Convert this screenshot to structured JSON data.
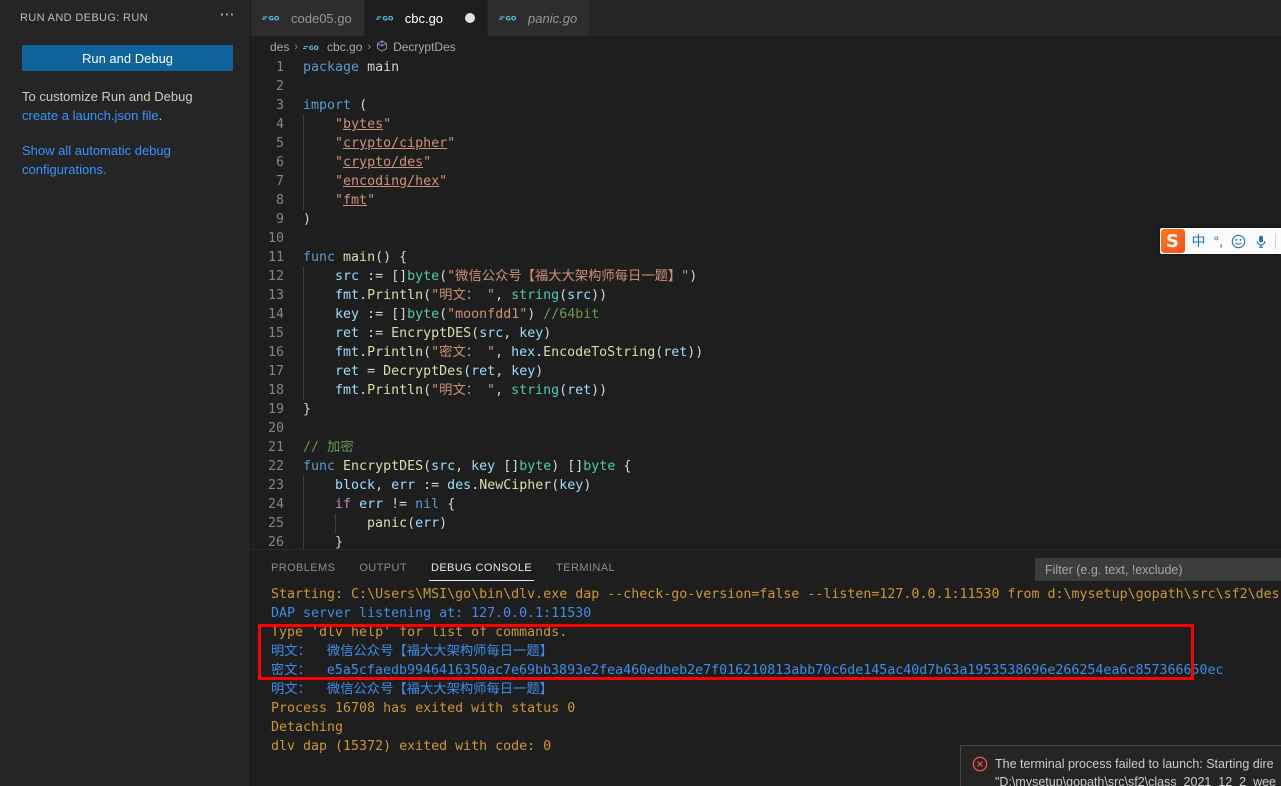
{
  "sidebar": {
    "header_title": "RUN AND DEBUG: RUN",
    "more_icon": "ellipsis-icon",
    "run_button_label": "Run and Debug",
    "hint_prefix": "To customize Run and Debug ",
    "hint_link": "create a launch.json file",
    "hint_suffix": ".",
    "secondary_link": "Show all automatic debug configurations.",
    "accent_color": "#0e639c",
    "link_color": "#3794ff"
  },
  "tabs": [
    {
      "label": "code05.go",
      "icon": "golang-icon",
      "active": false,
      "dirty": false,
      "italic": false
    },
    {
      "label": "cbc.go",
      "icon": "golang-icon",
      "active": true,
      "dirty": true,
      "italic": false
    },
    {
      "label": "panic.go",
      "icon": "golang-icon",
      "active": false,
      "dirty": false,
      "italic": true
    }
  ],
  "breadcrumb": {
    "items": [
      {
        "label": "des",
        "icon": ""
      },
      {
        "label": "cbc.go",
        "icon": "golang-icon"
      },
      {
        "label": "DecryptDes",
        "icon": "symbol-function-icon"
      }
    ],
    "separator": "›"
  },
  "editor": {
    "language": "go",
    "first_line": 1,
    "lines": [
      {
        "n": "1",
        "html": "<span class='kw'>package</span> <span class='pl'>main</span>"
      },
      {
        "n": "2",
        "html": ""
      },
      {
        "n": "3",
        "html": "<span class='kw'>import</span> <span class='pl'>(</span>"
      },
      {
        "n": "4",
        "html": "    <span class='str'>\"</span><span class='str-u'>bytes</span><span class='str'>\"</span>",
        "guide": 1
      },
      {
        "n": "5",
        "html": "    <span class='str'>\"</span><span class='str-u'>crypto/cipher</span><span class='str'>\"</span>",
        "guide": 1
      },
      {
        "n": "6",
        "html": "    <span class='str'>\"</span><span class='str-u'>crypto/des</span><span class='str'>\"</span>",
        "guide": 1
      },
      {
        "n": "7",
        "html": "    <span class='str'>\"</span><span class='str-u'>encoding/hex</span><span class='str'>\"</span>",
        "guide": 1
      },
      {
        "n": "8",
        "html": "    <span class='str'>\"</span><span class='str-u'>fmt</span><span class='str'>\"</span>",
        "guide": 1
      },
      {
        "n": "9",
        "html": "<span class='pl'>)</span>"
      },
      {
        "n": "10",
        "html": ""
      },
      {
        "n": "11",
        "html": "<span class='kw'>func</span> <span class='fn'>main</span><span class='pl'>() {</span>"
      },
      {
        "n": "12",
        "html": "    <span class='var'>src</span> <span class='pl'>:= []</span><span class='typ'>byte</span><span class='pl'>(</span><span class='str'>\"微信公众号【福大大架构师每日一题】\"</span><span class='pl'>)</span>",
        "guide": 1
      },
      {
        "n": "13",
        "html": "    <span class='var'>fmt</span><span class='pl'>.</span><span class='fn'>Println</span><span class='pl'>(</span><span class='str'>\"明文： \"</span><span class='pl'>, </span><span class='typ'>string</span><span class='pl'>(</span><span class='var'>src</span><span class='pl'>))</span>",
        "guide": 1
      },
      {
        "n": "14",
        "html": "    <span class='var'>key</span> <span class='pl'>:= []</span><span class='typ'>byte</span><span class='pl'>(</span><span class='str'>\"moonfdd1\"</span><span class='pl'>) </span><span class='cmt'>//64bit</span>",
        "guide": 1
      },
      {
        "n": "15",
        "html": "    <span class='var'>ret</span> <span class='pl'>:= </span><span class='fn'>EncryptDES</span><span class='pl'>(</span><span class='var'>src</span><span class='pl'>, </span><span class='var'>key</span><span class='pl'>)</span>",
        "guide": 1
      },
      {
        "n": "16",
        "html": "    <span class='var'>fmt</span><span class='pl'>.</span><span class='fn'>Println</span><span class='pl'>(</span><span class='str'>\"密文： \"</span><span class='pl'>, </span><span class='var'>hex</span><span class='pl'>.</span><span class='fn'>EncodeToString</span><span class='pl'>(</span><span class='var'>ret</span><span class='pl'>))</span>",
        "guide": 1
      },
      {
        "n": "17",
        "html": "    <span class='var'>ret</span> <span class='pl'>= </span><span class='fn'>DecryptDes</span><span class='pl'>(</span><span class='var'>ret</span><span class='pl'>, </span><span class='var'>key</span><span class='pl'>)</span>",
        "guide": 1
      },
      {
        "n": "18",
        "html": "    <span class='var'>fmt</span><span class='pl'>.</span><span class='fn'>Println</span><span class='pl'>(</span><span class='str'>\"明文： \"</span><span class='pl'>, </span><span class='typ'>string</span><span class='pl'>(</span><span class='var'>ret</span><span class='pl'>))</span>",
        "guide": 1
      },
      {
        "n": "19",
        "html": "<span class='pl'>}</span>"
      },
      {
        "n": "20",
        "html": ""
      },
      {
        "n": "21",
        "html": "<span class='cmt'>// 加密</span>"
      },
      {
        "n": "22",
        "html": "<span class='kw'>func</span> <span class='fn'>EncryptDES</span><span class='pl'>(</span><span class='var'>src</span><span class='pl'>, </span><span class='var'>key</span> <span class='pl'>[]</span><span class='typ'>byte</span><span class='pl'>) []</span><span class='typ'>byte</span> <span class='pl'>{</span>"
      },
      {
        "n": "23",
        "html": "    <span class='var'>block</span><span class='pl'>, </span><span class='var'>err</span> <span class='pl'>:= </span><span class='var'>des</span><span class='pl'>.</span><span class='fn'>NewCipher</span><span class='pl'>(</span><span class='var'>key</span><span class='pl'>)</span>",
        "guide": 1
      },
      {
        "n": "24",
        "html": "    <span class='kw2'>if</span> <span class='var'>err</span> <span class='pl'>!= </span><span class='kw'>nil</span> <span class='pl'>{</span>",
        "guide": 1
      },
      {
        "n": "25",
        "html": "        <span class='fn'>panic</span><span class='pl'>(</span><span class='var'>err</span><span class='pl'>)</span>",
        "guide": 2
      },
      {
        "n": "26",
        "html": "    <span class='pl'>}</span>",
        "guide": 1
      }
    ]
  },
  "panel": {
    "tabs": [
      {
        "label": "PROBLEMS",
        "active": false
      },
      {
        "label": "OUTPUT",
        "active": false
      },
      {
        "label": "DEBUG CONSOLE",
        "active": true
      },
      {
        "label": "TERMINAL",
        "active": false
      }
    ],
    "filter_placeholder": "Filter (e.g. text, !exclude)",
    "filter_value": "",
    "console_lines": [
      {
        "text": "Starting: C:\\Users\\MSI\\go\\bin\\dlv.exe dap --check-go-version=false --listen=127.0.0.1:11530 from d:\\mysetup\\gopath\\src\\sf2\\des",
        "color": "amber"
      },
      {
        "text": "DAP server listening at: 127.0.0.1:11530",
        "color": "blue"
      },
      {
        "text": "Type 'dlv help' for list of commands.",
        "color": "amber"
      },
      {
        "text": "明文：  微信公众号【福大大架构师每日一题】",
        "color": "blue"
      },
      {
        "text": "密文：  e5a5cfaedb9946416350ac7e69bb3893e2fea460edbeb2e7f016210813abb70c6de145ac40d7b63a1953538696e266254ea6c857366650ec",
        "color": "blue"
      },
      {
        "text": "明文：  微信公众号【福大大架构师每日一题】",
        "color": "blue"
      },
      {
        "text": "Process 16708 has exited with status 0",
        "color": "amber"
      },
      {
        "text": "Detaching",
        "color": "amber"
      },
      {
        "text": "dlv dap (15372) exited with code: 0",
        "color": "amber"
      }
    ],
    "highlight_box_color": "#ff0000"
  },
  "toast": {
    "icon": "error-circle-icon",
    "line1": "The terminal process failed to launch: Starting dire",
    "line2": "\"D:\\mysetup\\gopath\\src\\sf2\\class_2021_12_2_wee"
  },
  "ime": {
    "logo": "sogou-logo-icon",
    "items": [
      {
        "label": "中",
        "name": "ime-mode-chinese"
      },
      {
        "label": "°,",
        "name": "ime-punctuation-toggle"
      },
      {
        "label": "☺",
        "name": "ime-emoji-icon"
      },
      {
        "label": "🎤",
        "name": "ime-voice-icon"
      }
    ]
  }
}
